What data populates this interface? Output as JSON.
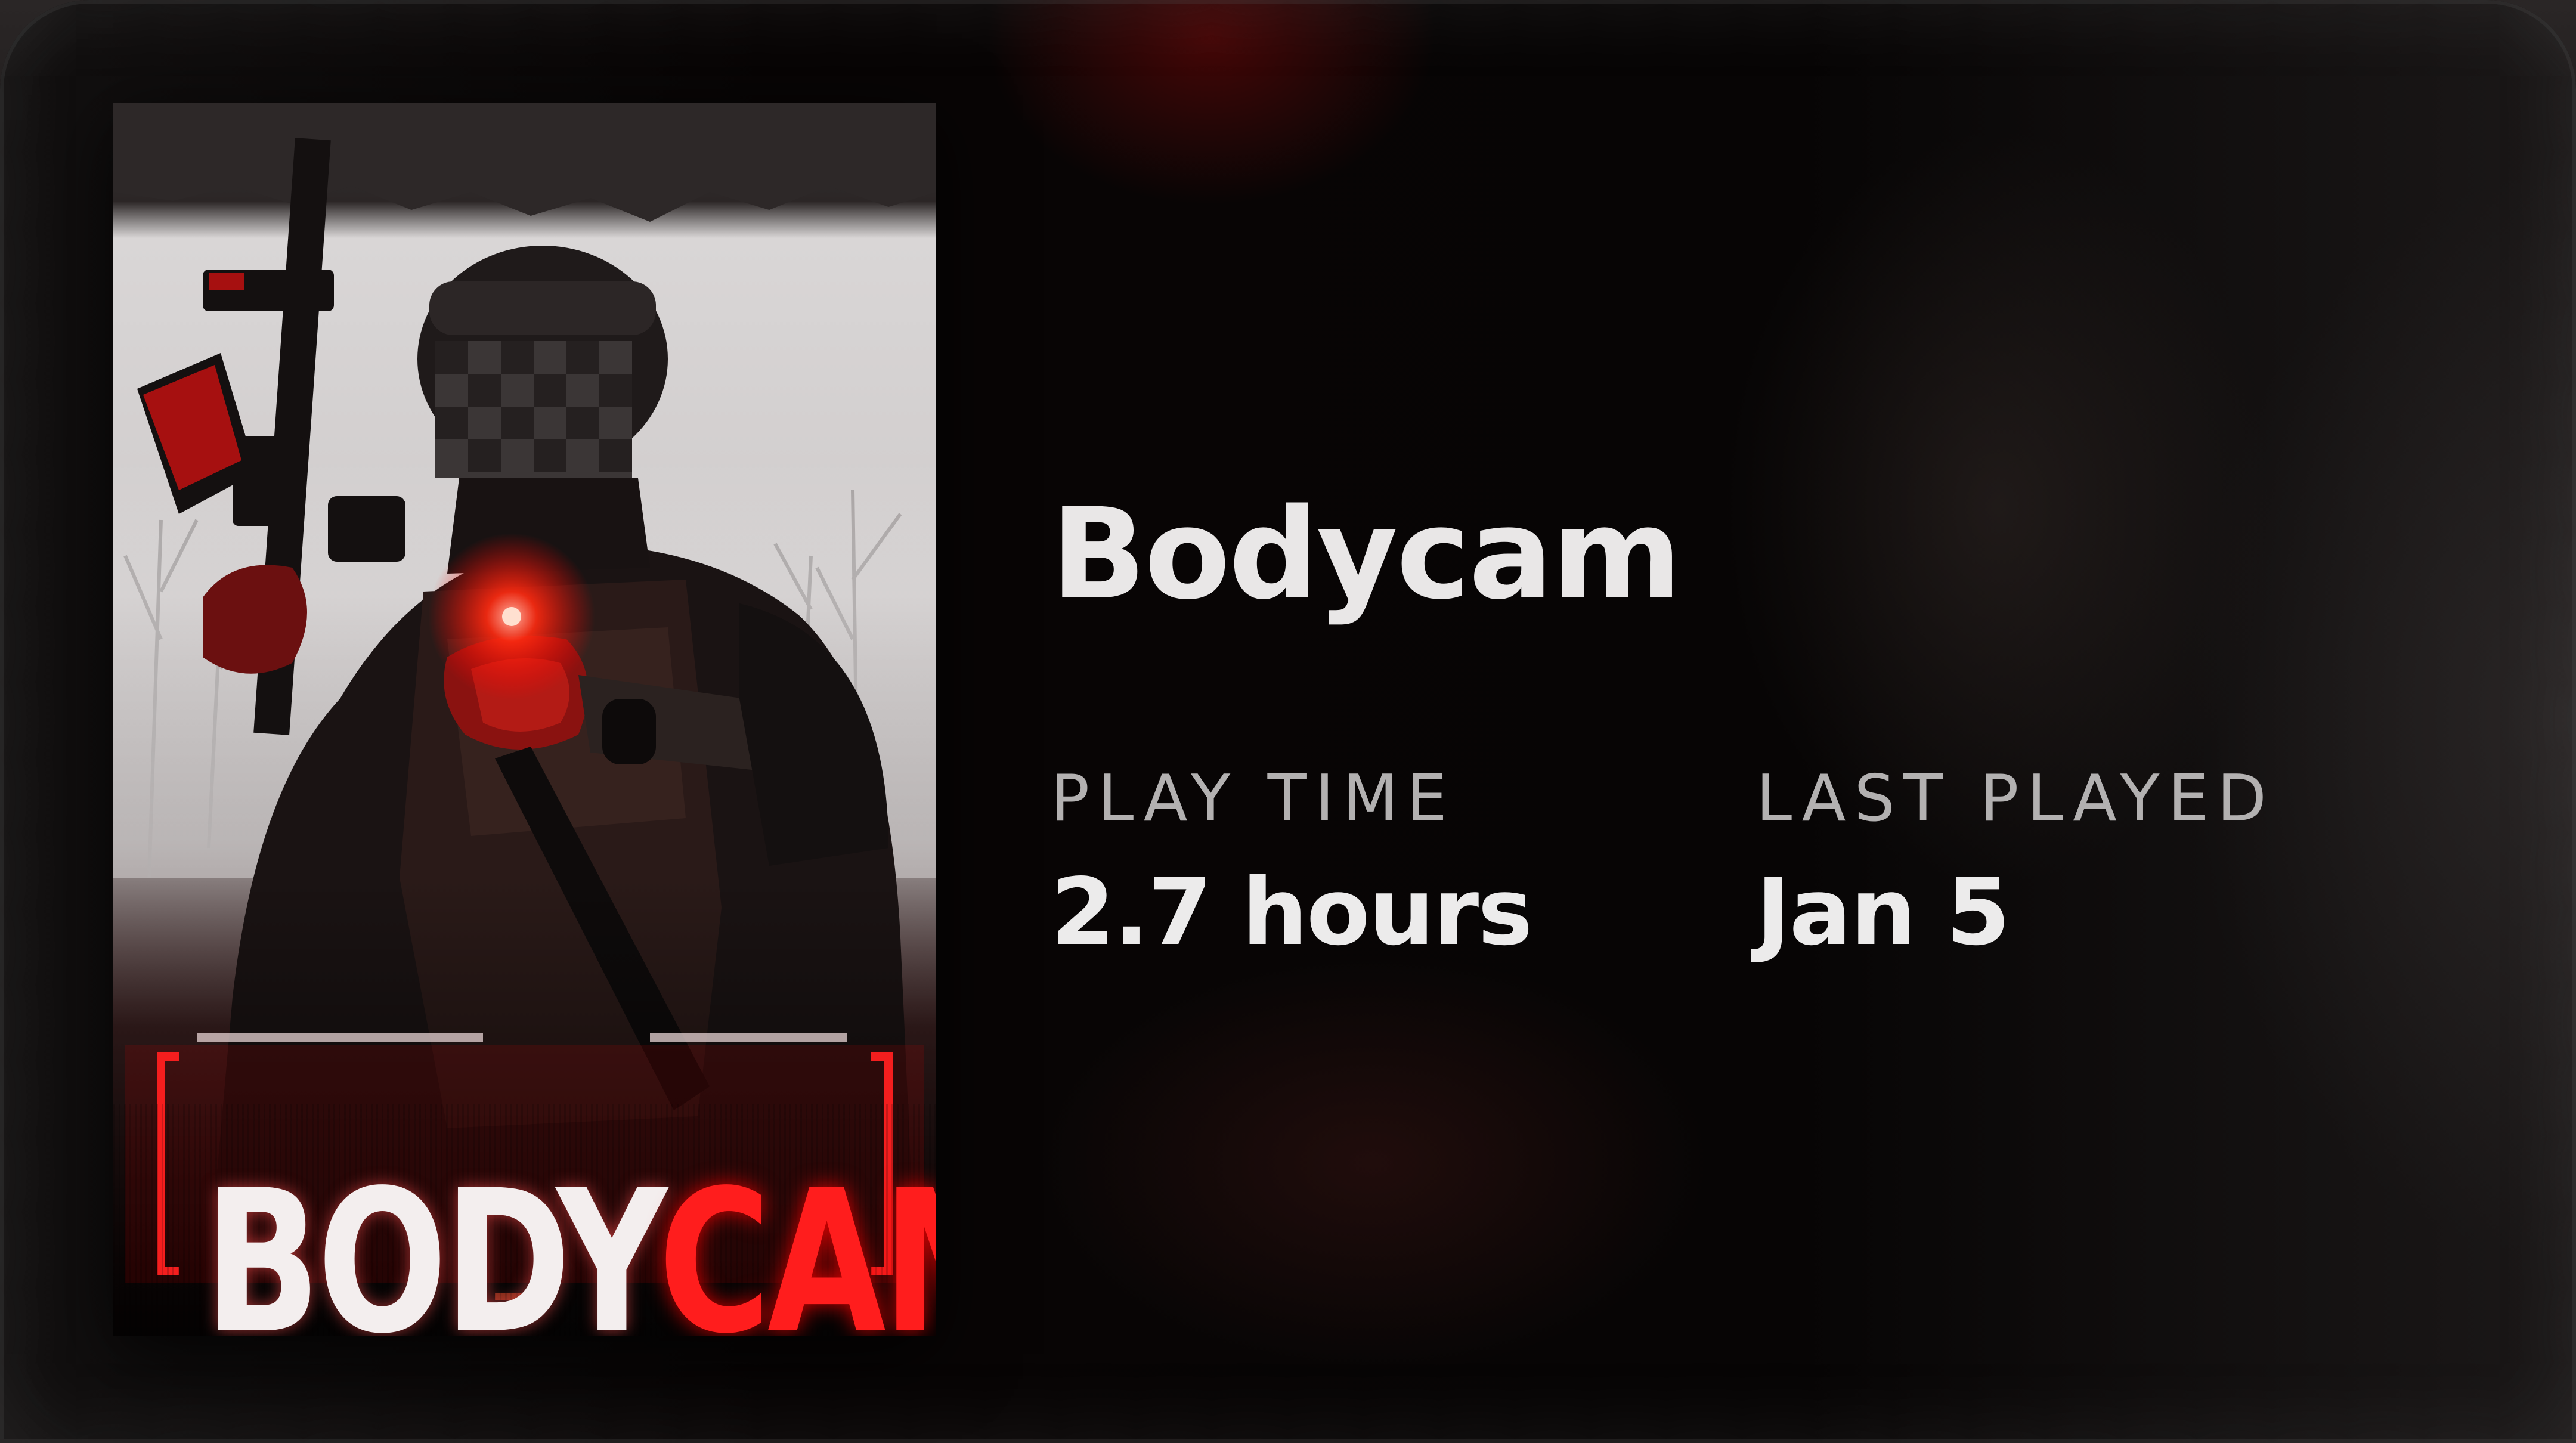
{
  "game": {
    "title": "Bodycam",
    "cover_art": {
      "title_text_white": "BODY",
      "title_text_red": "CAM"
    },
    "stats": {
      "play_time_label": "PLAY TIME",
      "play_time_value": "2.7 hours",
      "last_played_label": "LAST PLAYED",
      "last_played_value": "Jan 5"
    }
  },
  "colors": {
    "accent_red": "#ff1d1d",
    "text_primary": "#e9e7e7",
    "text_secondary": "#b3b1b1"
  }
}
